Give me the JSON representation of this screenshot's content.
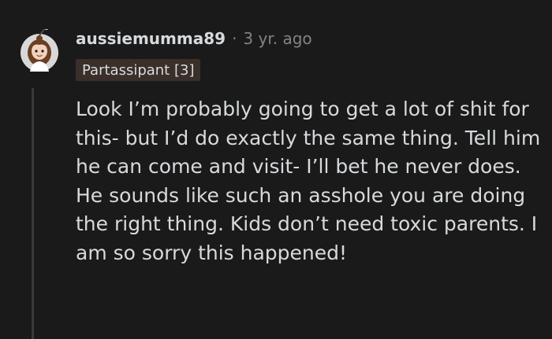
{
  "comment": {
    "username": "aussiemumma89",
    "separator": "·",
    "time_ago": "3 yr. ago",
    "flair": "Partassipant [3]",
    "body": "Look I’m probably going to get a lot of shit for this- but I’d do exactly the same thing. Tell him he can come and visit- I’ll bet he never does. He sounds like such an asshole you are doing the right thing. Kids don’t need toxic parents. I am so sorry this happened!"
  },
  "colors": {
    "background": "#1a1a1b",
    "text": "#d7dadc",
    "meta": "#818384",
    "flair_bg": "#3a2f29",
    "thread_line": "#3a3a3c"
  },
  "icons": {
    "avatar": "user-avatar-icon"
  }
}
